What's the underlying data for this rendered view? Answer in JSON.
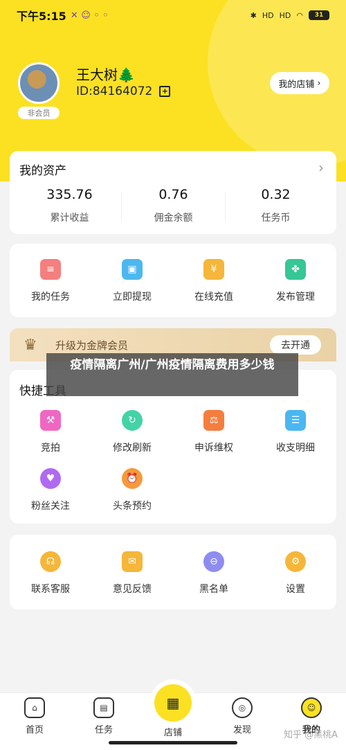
{
  "status_bar": {
    "time": "下午5:15",
    "signal_1": "HD",
    "signal_2": "HD",
    "battery": "31"
  },
  "profile": {
    "name": "王大树🌲",
    "id": "ID:84164072",
    "member_badge": "非会员",
    "shop_button": "我的店铺"
  },
  "assets": {
    "title": "我的资产",
    "items": [
      {
        "value": "335.76",
        "label": "累计收益"
      },
      {
        "value": "0.76",
        "label": "佣金余额"
      },
      {
        "value": "0.32",
        "label": "任务币"
      }
    ]
  },
  "services": [
    {
      "label": "我的任务",
      "icon": "task-icon",
      "color": "#f47f7f"
    },
    {
      "label": "立即提现",
      "icon": "wallet-icon",
      "color": "#4db8ef"
    },
    {
      "label": "在线充值",
      "icon": "recharge-icon",
      "color": "#f5b63a"
    },
    {
      "label": "发布管理",
      "icon": "clover-icon",
      "color": "#35c795"
    }
  ],
  "vip": {
    "text": "升级为金牌会员",
    "button": "去开通"
  },
  "quick_tools": {
    "title": "快捷工具",
    "items": [
      {
        "label": "竞拍",
        "icon": "auction-icon",
        "color": "#f067c3"
      },
      {
        "label": "修改刷新",
        "icon": "refresh-icon",
        "color": "#43d3a6"
      },
      {
        "label": "申诉维权",
        "icon": "gavel-icon",
        "color": "#f57d3d"
      },
      {
        "label": "收支明细",
        "icon": "list-icon",
        "color": "#49b7f0"
      },
      {
        "label": "粉丝关注",
        "icon": "fans-icon",
        "color": "#b06af0"
      },
      {
        "label": "头条预约",
        "icon": "alarm-icon",
        "color": "#f59a3a"
      }
    ]
  },
  "support": [
    {
      "label": "联系客服",
      "icon": "headset-icon",
      "color": "#f5b63a"
    },
    {
      "label": "意见反馈",
      "icon": "mail-icon",
      "color": "#f5b63a"
    },
    {
      "label": "黑名单",
      "icon": "blocked-user-icon",
      "color": "#8e8cf0"
    },
    {
      "label": "设置",
      "icon": "gear-icon",
      "color": "#f5b63a"
    }
  ],
  "overlay_text": "疫情隔离广州/广州疫情隔离费用多少钱",
  "tabbar": [
    {
      "label": "首页",
      "icon": "home-icon"
    },
    {
      "label": "任务",
      "icon": "task-box-icon"
    },
    {
      "label": "店铺",
      "icon": "shop-icon"
    },
    {
      "label": "发现",
      "icon": "discover-icon"
    },
    {
      "label": "我的",
      "icon": "profile-icon"
    }
  ],
  "watermark": "知乎 @黑桃A"
}
